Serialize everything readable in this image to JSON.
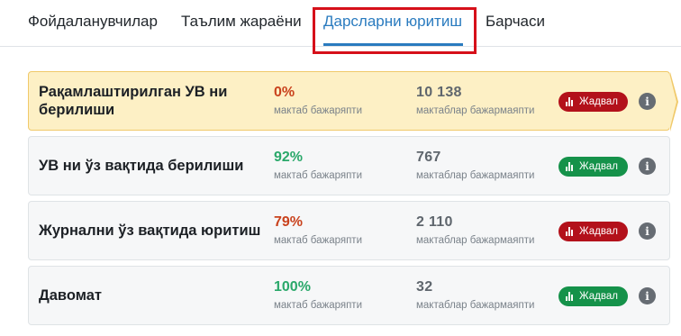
{
  "tabs": [
    {
      "label": "Фойдаланувчилар"
    },
    {
      "label": "Таълим жараёни"
    },
    {
      "label": "Дарсларни юритиш"
    },
    {
      "label": "Барчаси"
    }
  ],
  "active_tab": "Дарсларни юритиш",
  "cards": [
    {
      "title": "Рақамлаштирилган УВ ни берилиши",
      "percent": "0%",
      "percent_sub": "мактаб бажаряпти",
      "count": "10 138",
      "count_sub": "мактаблар бажармаяпти",
      "badge_label": "Жадвал",
      "status": "bad",
      "selected": true
    },
    {
      "title": "УВ ни ўз вақтида берилиши",
      "percent": "92%",
      "percent_sub": "мактаб бажаряпти",
      "count": "767",
      "count_sub": "мактаблар бажармаяпти",
      "badge_label": "Жадвал",
      "status": "good",
      "selected": false
    },
    {
      "title": "Журнални ўз вақтида юритиш",
      "percent": "79%",
      "percent_sub": "мактаб бажаряпти",
      "count": "2 110",
      "count_sub": "мактаблар бажармаяпти",
      "badge_label": "Жадвал",
      "status": "bad",
      "selected": false
    },
    {
      "title": "Давомат",
      "percent": "100%",
      "percent_sub": "мактаб бажаряпти",
      "count": "32",
      "count_sub": "мактаблар бажармаяпти",
      "badge_label": "Жадвал",
      "status": "good",
      "selected": false
    }
  ],
  "colors": {
    "accent": "#2a7bbf",
    "percent_bad": "#c9421d",
    "percent_good": "#2aa86a",
    "badge_bad": "#b3111b",
    "badge_good": "#15924a",
    "highlight_outline": "#d6101a",
    "selected_card": "#fdf0c5"
  },
  "icons": {
    "badge": "bar-chart-icon",
    "info": "info-icon"
  }
}
